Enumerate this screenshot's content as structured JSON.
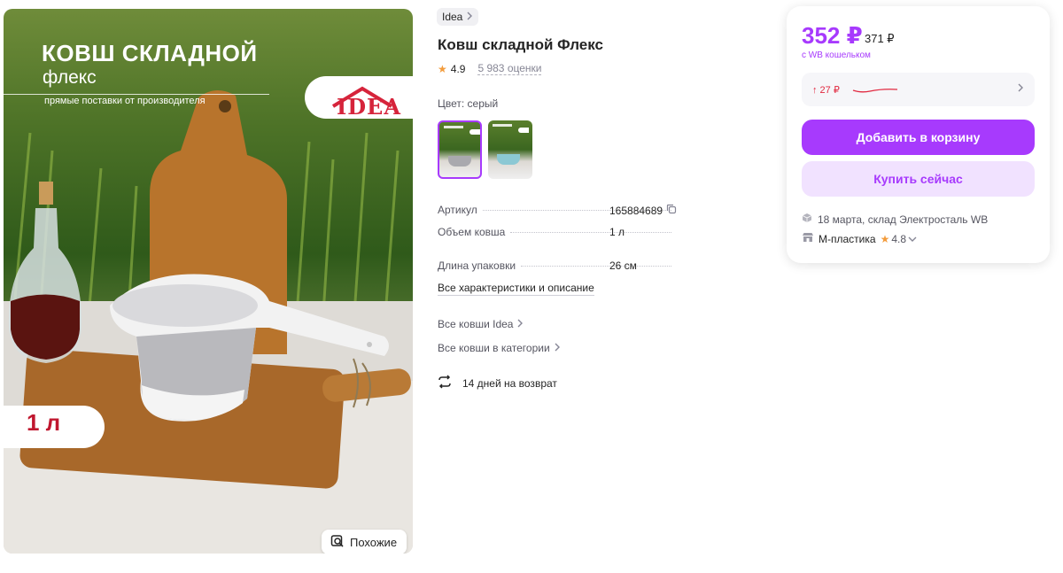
{
  "photo": {
    "title": "КОВШ СКЛАДНОЙ",
    "subtitle": "флекс",
    "note": "прямые поставки от производителя",
    "logo": "IDEA",
    "volume": "1 л",
    "similar_label": "Похожие"
  },
  "product": {
    "brand": "Idea",
    "title": "Ковш складной Флекс",
    "rating": "4.9",
    "reviews": "5 983 оценки",
    "color_label": "Цвет: серый"
  },
  "specs": [
    {
      "key": "Артикул",
      "value": "165884689"
    },
    {
      "key": "Объем ковша",
      "value": "1 л"
    },
    {
      "key": "Длина упаковки",
      "value": "26 см"
    }
  ],
  "links": {
    "all_specs": "Все характеристики и описание",
    "brand_link": "Все ковши Idea",
    "category_link": "Все ковши в категории",
    "returns": "14 дней на возврат"
  },
  "offer": {
    "price": "352 ₽",
    "old_price": "371 ₽",
    "wallet_note": "с WB кошельком",
    "price_change": "↑ 27 ₽",
    "add_to_cart": "Добавить в корзину",
    "buy_now": "Купить сейчас",
    "delivery": "18 марта, склад Электросталь WB",
    "seller": "М-пластика",
    "seller_rating": "4.8"
  },
  "colors": {
    "accent": "#a73afd",
    "accent_light": "#f1e2ff",
    "price_up": "#e12940",
    "star": "#f39c3c"
  }
}
